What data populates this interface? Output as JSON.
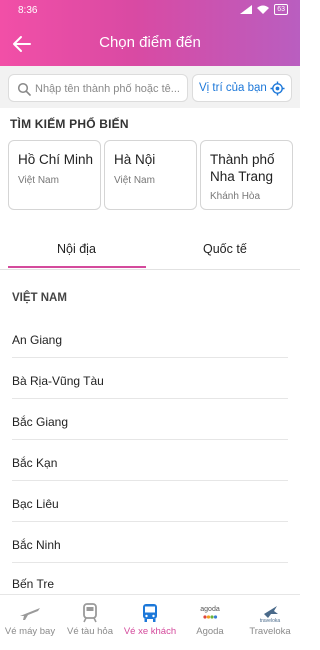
{
  "status_bar": {
    "time": "8:36",
    "battery": "63"
  },
  "header": {
    "title": "Chọn điểm đến"
  },
  "search": {
    "placeholder": "Nhập tên thành phố hoặc tê...",
    "location_label": "Vị trí của bạn"
  },
  "popular": {
    "heading": "TÌM KIẾM PHỔ BIẾN",
    "cards": [
      {
        "city": "Hồ Chí Minh",
        "country": "Việt Nam"
      },
      {
        "city": "Hà Nội",
        "country": "Việt Nam"
      },
      {
        "city": "Thành phố Nha Trang",
        "city_lines": [
          "Thành phố",
          "Nha Trang"
        ],
        "country": "Khánh Hòa"
      }
    ]
  },
  "tabs": [
    {
      "label": "Nội địa",
      "active": true
    },
    {
      "label": "Quốc tế",
      "active": false
    }
  ],
  "list": {
    "section": "VIỆT NAM",
    "provinces": [
      "An Giang",
      "Bà Rịa-Vũng Tàu",
      "Bắc Giang",
      "Bắc Kạn",
      "Bạc Liêu",
      "Bắc Ninh",
      "Bến Tre"
    ]
  },
  "bottom_nav": [
    {
      "label": "Vé máy bay",
      "icon": "plane-icon",
      "active": false
    },
    {
      "label": "Vé tàu hỏa",
      "icon": "train-icon",
      "active": false
    },
    {
      "label": "Vé xe khách",
      "icon": "bus-icon",
      "active": true
    },
    {
      "label": "Agoda",
      "icon": "agoda-logo",
      "icon_text": "agoda",
      "active": false
    },
    {
      "label": "Traveloka",
      "icon": "traveloka-logo",
      "icon_text": "traveloka",
      "active": false
    }
  ],
  "colors": {
    "accent": "#d44a9c",
    "link": "#1d78d9",
    "header_start": "#f24fa7",
    "header_end": "#b95ec0"
  }
}
